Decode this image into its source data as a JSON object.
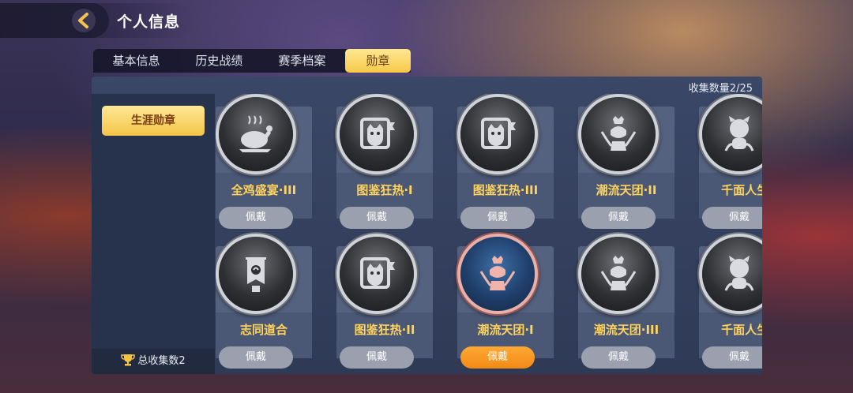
{
  "header": {
    "title": "个人信息"
  },
  "tabs": [
    "基本信息",
    "历史战绩",
    "赛季档案",
    "勋章"
  ],
  "sidebar": {
    "category": "生涯勋章",
    "total_label": "总收集数2"
  },
  "collection_count": "收集数量2/25",
  "medals": [
    {
      "name": "全鸡盛宴·III",
      "button": "佩戴",
      "icon": "roast-chicken-icon",
      "active": false
    },
    {
      "name": "图鉴狂热·I",
      "button": "佩戴",
      "icon": "cat-album-icon",
      "active": false
    },
    {
      "name": "图鉴狂热·III",
      "button": "佩戴",
      "icon": "cat-album-icon",
      "active": false
    },
    {
      "name": "潮流天团·II",
      "button": "佩戴",
      "icon": "trophy-bust-icon",
      "active": false
    },
    {
      "name": "千面人生·",
      "button": "佩戴",
      "icon": "mascot-icon",
      "active": false
    },
    {
      "name": "志同道合",
      "button": "佩戴",
      "icon": "banner-icon",
      "active": false
    },
    {
      "name": "图鉴狂热·II",
      "button": "佩戴",
      "icon": "cat-album-icon",
      "active": false
    },
    {
      "name": "潮流天团·I",
      "button": "佩戴",
      "icon": "trophy-bust-icon",
      "active": true
    },
    {
      "name": "潮流天团·III",
      "button": "佩戴",
      "icon": "trophy-bust-icon",
      "active": false
    },
    {
      "name": "千面人生·",
      "button": "佩戴",
      "icon": "mascot-icon",
      "active": false
    }
  ]
}
